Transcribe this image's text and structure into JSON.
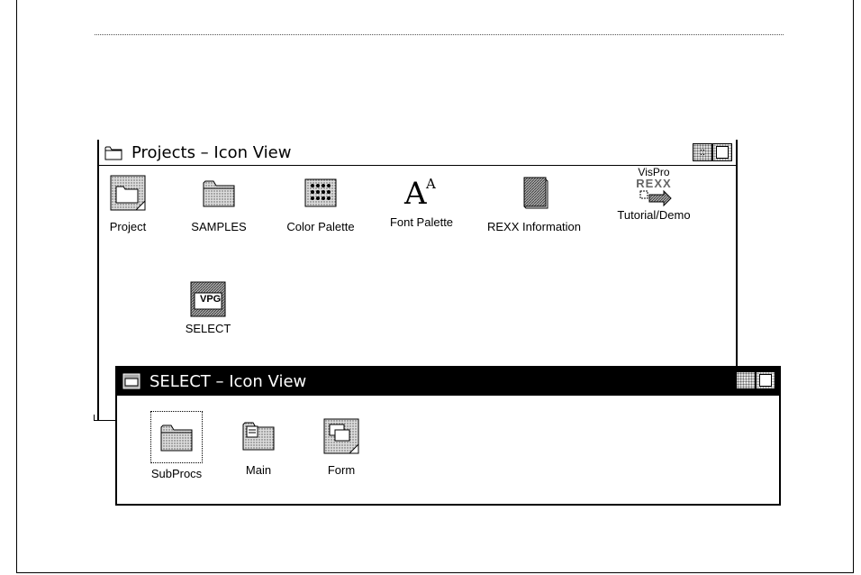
{
  "projects_window": {
    "title": "Projects – Icon View",
    "icons": [
      {
        "label": "Project",
        "icon": "project-icon"
      },
      {
        "label": "SAMPLES",
        "icon": "folder-icon"
      },
      {
        "label": "Color Palette",
        "icon": "color-palette-icon"
      },
      {
        "label": "Font Palette",
        "icon": "font-palette-icon"
      },
      {
        "label": "REXX Information",
        "icon": "book-icon"
      },
      {
        "label": "Tutorial/Demo",
        "icon": "visprorexx-icon"
      },
      {
        "label": "SELECT",
        "icon": "vpg-program-icon"
      }
    ],
    "tutorial_icon_text": [
      "VisPro",
      "REXX"
    ],
    "select_icon_text": "VPG",
    "font_icon_text": "A"
  },
  "select_window": {
    "title": "SELECT – Icon View",
    "icons": [
      {
        "label": "SubProcs",
        "icon": "folder-icon"
      },
      {
        "label": "Main",
        "icon": "main-folder-icon"
      },
      {
        "label": "Form",
        "icon": "form-icon"
      }
    ]
  },
  "window_buttons": {
    "minimize_glyph": "::"
  }
}
